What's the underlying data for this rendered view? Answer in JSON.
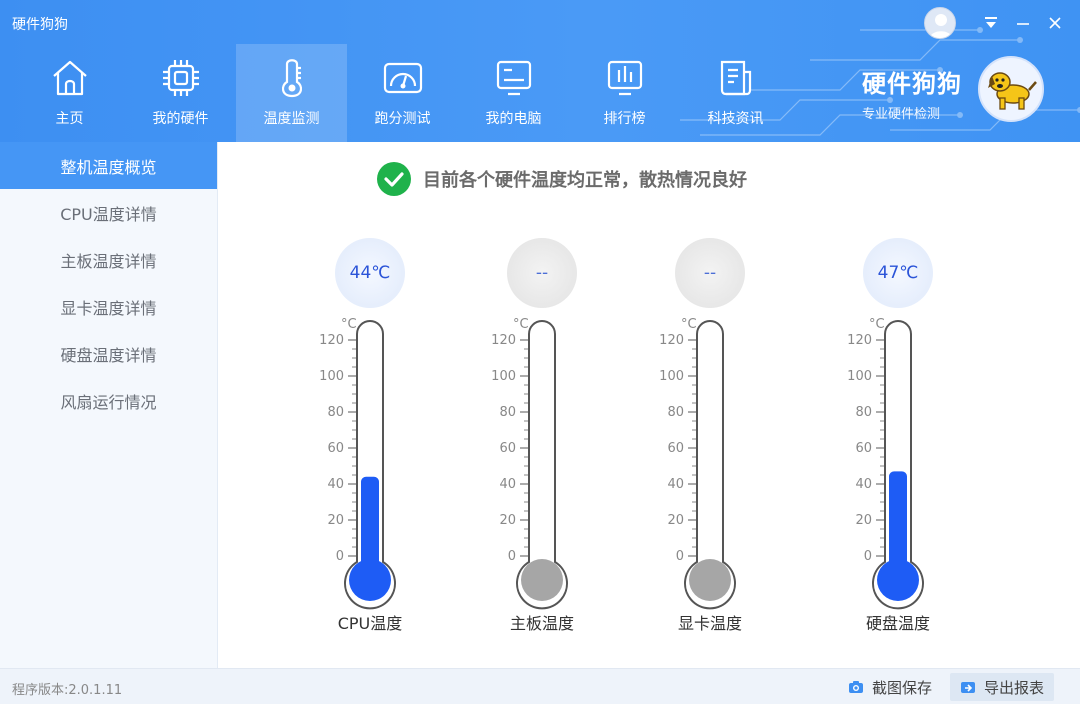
{
  "window": {
    "title": "硬件狗狗",
    "controls": [
      "user-avatar-icon",
      "menu-down-icon",
      "minimize-icon",
      "close-icon"
    ]
  },
  "nav": {
    "items": [
      {
        "label": "主页",
        "icon": "home-icon"
      },
      {
        "label": "我的硬件",
        "icon": "chip-icon"
      },
      {
        "label": "温度监测",
        "icon": "thermometer-icon",
        "active": true
      },
      {
        "label": "跑分测试",
        "icon": "speedometer-icon"
      },
      {
        "label": "我的电脑",
        "icon": "computer-icon"
      },
      {
        "label": "排行榜",
        "icon": "ranking-icon"
      },
      {
        "label": "科技资讯",
        "icon": "news-icon"
      }
    ]
  },
  "brand": {
    "title": "硬件狗狗",
    "subtitle": "专业硬件检测"
  },
  "sidebar": {
    "items": [
      {
        "label": "整机温度概览",
        "active": true
      },
      {
        "label": "CPU温度详情"
      },
      {
        "label": "主板温度详情"
      },
      {
        "label": "显卡温度详情"
      },
      {
        "label": "硬盘温度详情"
      },
      {
        "label": "风扇运行情况"
      }
    ]
  },
  "status": {
    "message": "目前各个硬件温度均正常，散热情况良好",
    "icon": "check-circle-icon"
  },
  "thermometers": {
    "unit": "°C",
    "scale_ticks": [
      "120",
      "100",
      "80",
      "60",
      "40",
      "20",
      "0"
    ],
    "scale_max": 120,
    "items": [
      {
        "label": "CPU温度",
        "reading": "44℃",
        "value": 44
      },
      {
        "label": "主板温度",
        "reading": "--",
        "value": null
      },
      {
        "label": "显卡温度",
        "reading": "--",
        "value": null
      },
      {
        "label": "硬盘温度",
        "reading": "47℃",
        "value": 47
      }
    ]
  },
  "footer": {
    "version": "程序版本:2.0.1.11",
    "screenshot_label": "截图保存",
    "export_label": "导出报表"
  },
  "colors": {
    "header": "#4596f5",
    "mercury": "#1e5cf5",
    "inactive_bulb": "#a6a6a6",
    "status_ok": "#1fb24b"
  }
}
